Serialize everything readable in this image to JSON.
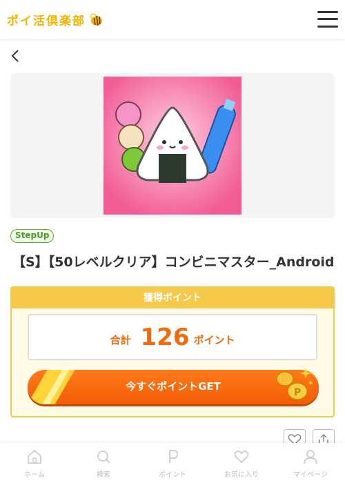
{
  "header": {
    "logo_text": "ポイ活倶楽部",
    "logo_icon": "bee-icon",
    "menu_icon": "hamburger-menu-icon"
  },
  "back_icon": "chevron-left-icon",
  "banner": {
    "icon": "onigiri-game-app-icon"
  },
  "tag": "StepUp",
  "title": "【S】【50レベルクリア】コンビニマスター_Android",
  "points_card": {
    "header": "獲得ポイント",
    "total_label": "合計",
    "points": "126",
    "unit": "ポイント",
    "cta": "今すぐポイントGET"
  },
  "actions": {
    "favorite_icon": "heart-icon",
    "share_icon": "share-icon"
  },
  "bottom_nav": [
    {
      "label": "ホーム",
      "icon": "home-icon"
    },
    {
      "label": "検索",
      "icon": "search-icon"
    },
    {
      "label": "ポイント",
      "icon": "point-icon"
    },
    {
      "label": "お気に入り",
      "icon": "heart-icon"
    },
    {
      "label": "マイページ",
      "icon": "user-icon"
    }
  ],
  "colors": {
    "brand_yellow": "#f7c948",
    "accent_orange": "#f26a0a",
    "tag_green": "#5aaa2e"
  }
}
